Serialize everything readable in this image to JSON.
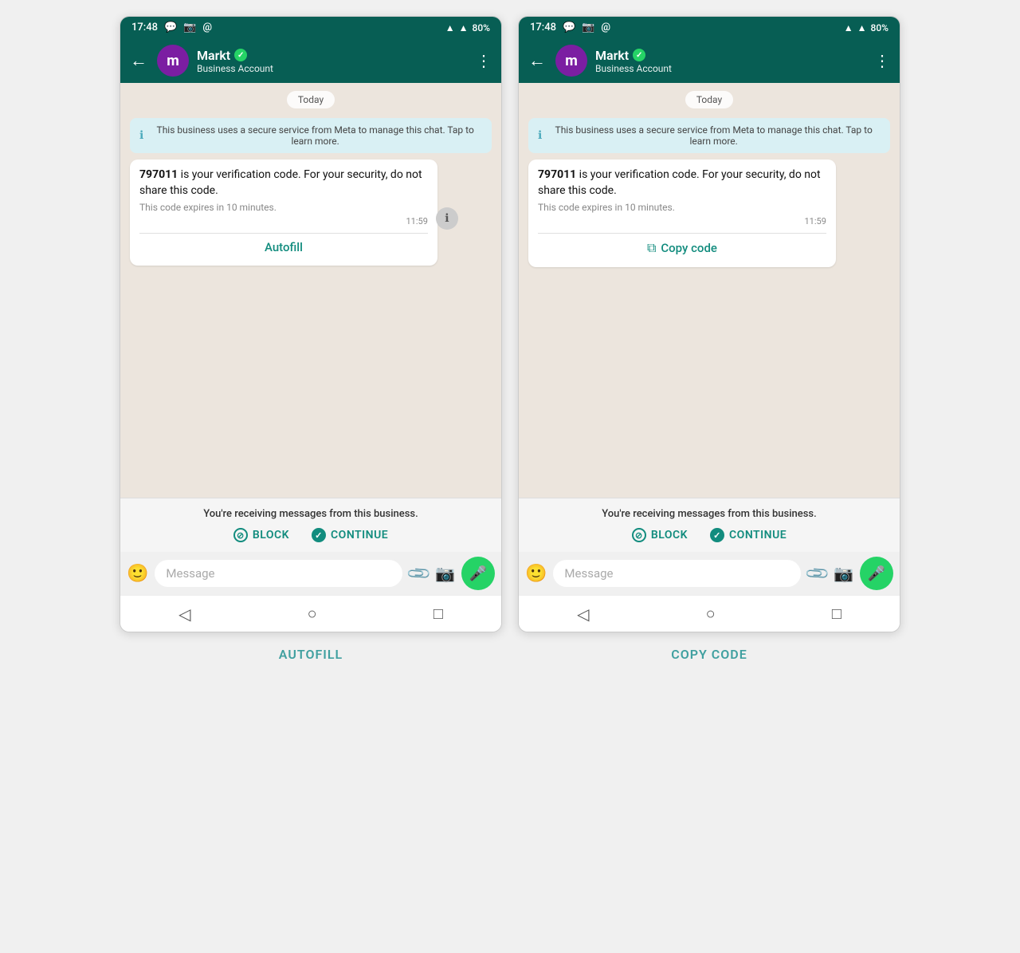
{
  "page": {
    "background": "#f0f0f0"
  },
  "labels": {
    "autofill": "AUTOFILL",
    "copy_code": "COPY CODE"
  },
  "phone_left": {
    "status_bar": {
      "time": "17:48",
      "icons": [
        "whatsapp",
        "instagram",
        "at"
      ],
      "signal": "▲",
      "network": "▲",
      "battery": "80%"
    },
    "header": {
      "back": "←",
      "avatar_letter": "m",
      "name": "Markt",
      "verified": "✓",
      "subtitle": "Business Account",
      "more": "⋮"
    },
    "chat": {
      "date_label": "Today",
      "info_banner": "This business uses a secure service from Meta to manage this chat. Tap to learn more.",
      "message_main": "797011 is your verification code. For your security, do not share this code.",
      "message_sub": "This code expires in 10 minutes.",
      "message_time": "11:59",
      "action_label": "Autofill"
    },
    "bottom": {
      "notice": "You're receiving messages from this business.",
      "block_label": "BLOCK",
      "continue_label": "CONTINUE"
    },
    "input": {
      "placeholder": "Message"
    },
    "nav": {
      "back": "◁",
      "home": "○",
      "recent": "□"
    }
  },
  "phone_right": {
    "status_bar": {
      "time": "17:48",
      "icons": [
        "whatsapp",
        "instagram",
        "at"
      ],
      "signal": "▲",
      "network": "▲",
      "battery": "80%"
    },
    "header": {
      "back": "←",
      "avatar_letter": "m",
      "name": "Markt",
      "verified": "✓",
      "subtitle": "Business Account",
      "more": "⋮"
    },
    "chat": {
      "date_label": "Today",
      "info_banner": "This business uses a secure service from Meta to manage this chat. Tap to learn more.",
      "message_main": "797011 is your verification code. For your security, do not share this code.",
      "message_sub": "This code expires in 10 minutes.",
      "message_time": "11:59",
      "action_label": "Copy code"
    },
    "bottom": {
      "notice": "You're receiving messages from this business.",
      "block_label": "BLOCK",
      "continue_label": "CONTINUE"
    },
    "input": {
      "placeholder": "Message"
    },
    "nav": {
      "back": "◁",
      "home": "○",
      "recent": "□"
    }
  }
}
